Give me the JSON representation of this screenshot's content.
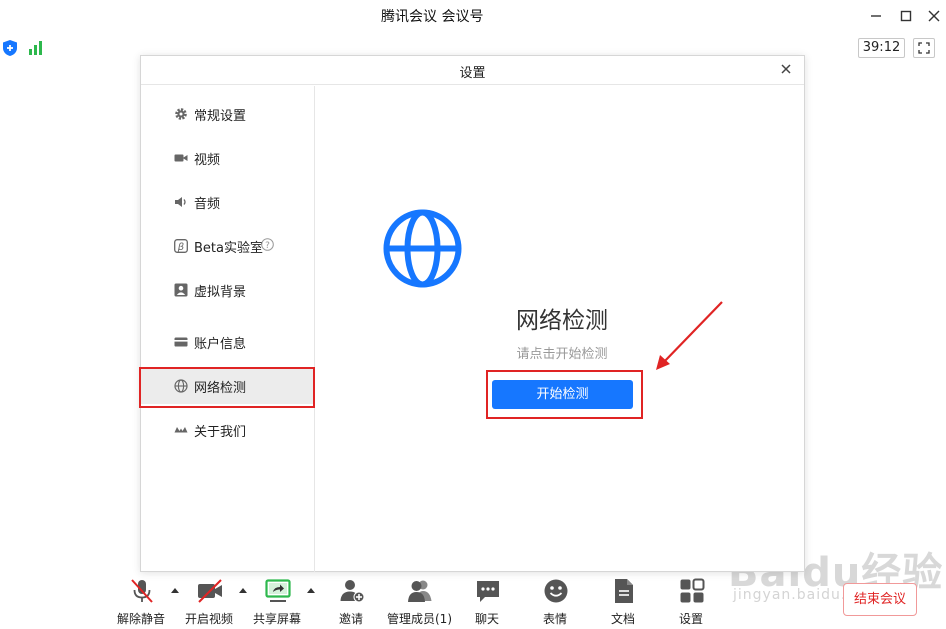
{
  "window": {
    "title": "腾讯会议 会议号:",
    "timer": "39:12"
  },
  "dialog": {
    "title": "设置",
    "nav_items": [
      {
        "label": "常规设置"
      },
      {
        "label": "视频"
      },
      {
        "label": "音频"
      },
      {
        "label": "Beta实验室"
      },
      {
        "label": "虚拟背景"
      },
      {
        "label": "账户信息"
      },
      {
        "label": "网络检测",
        "active": true
      },
      {
        "label": "关于我们"
      }
    ],
    "content": {
      "heading": "网络检测",
      "hint": "请点击开始检测",
      "start_button": "开始检测"
    }
  },
  "toolbar": {
    "items": [
      {
        "label": "解除静音",
        "icon": "mic-muted-icon"
      },
      {
        "label": "开启视频",
        "icon": "camera-off-icon"
      },
      {
        "label": "共享屏幕",
        "icon": "share-screen-icon"
      },
      {
        "label": "邀请",
        "icon": "invite-icon"
      },
      {
        "label": "管理成员(1)",
        "icon": "members-icon"
      },
      {
        "label": "聊天",
        "icon": "chat-icon"
      },
      {
        "label": "表情",
        "icon": "emoji-icon"
      },
      {
        "label": "文档",
        "icon": "document-icon"
      },
      {
        "label": "设置",
        "icon": "settings-grid-icon"
      }
    ],
    "end_meeting": "结束会议"
  },
  "watermark": {
    "main": "Baidu经验",
    "sub": "jingyan.baidu.com"
  },
  "colors": {
    "accent": "#1677ff",
    "highlight": "#e02424",
    "signal": "#2db84d"
  }
}
